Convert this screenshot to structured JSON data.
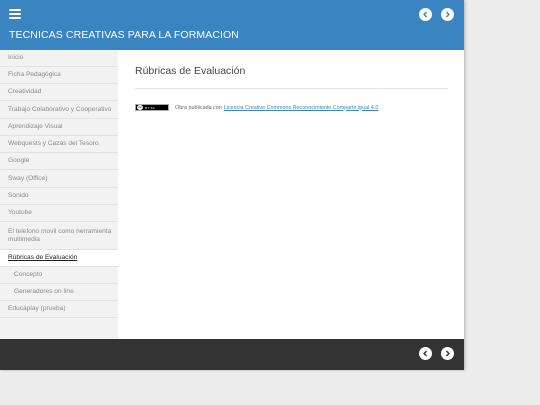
{
  "header": {
    "title": "TECNICAS CREATIVAS PARA LA FORMACION",
    "menu_icon": "hamburger-icon",
    "prev_icon": "chevron-left-icon",
    "next_icon": "chevron-right-icon",
    "color": "#3a84c1"
  },
  "sidebar": {
    "items": [
      {
        "label": "Inicio"
      },
      {
        "label": "Ficha Pedagógica"
      },
      {
        "label": "Creatividad"
      },
      {
        "label": "Trabajo Colaborativo y Cooperativo"
      },
      {
        "label": "Aprendizaje Visual"
      },
      {
        "label": "Webquests y Cazas del Tesoro"
      },
      {
        "label": "Google"
      },
      {
        "label": "Sway (Office)"
      },
      {
        "label": "Sonido"
      },
      {
        "label": "Youtube"
      },
      {
        "label": "El telefono movil como herramienta multimedia"
      },
      {
        "label": "Rúbricas de Evaluación",
        "active": true
      },
      {
        "label": "Concepto",
        "sub": true
      },
      {
        "label": "Generadores on line",
        "sub": true
      },
      {
        "label": "Educaplay (prueba)"
      }
    ]
  },
  "main": {
    "page_title": "Rúbricas de Evaluación",
    "license": {
      "badge_icon": "creative-commons-by-sa-icon",
      "badge_text": "BY SA",
      "prefix": "Obra publicada con",
      "link_text": "Licencia Creative Commons Reconocimiento Compartir igual 4.0"
    }
  },
  "footer": {
    "color": "#333333",
    "prev_icon": "chevron-left-icon",
    "next_icon": "chevron-right-icon"
  }
}
